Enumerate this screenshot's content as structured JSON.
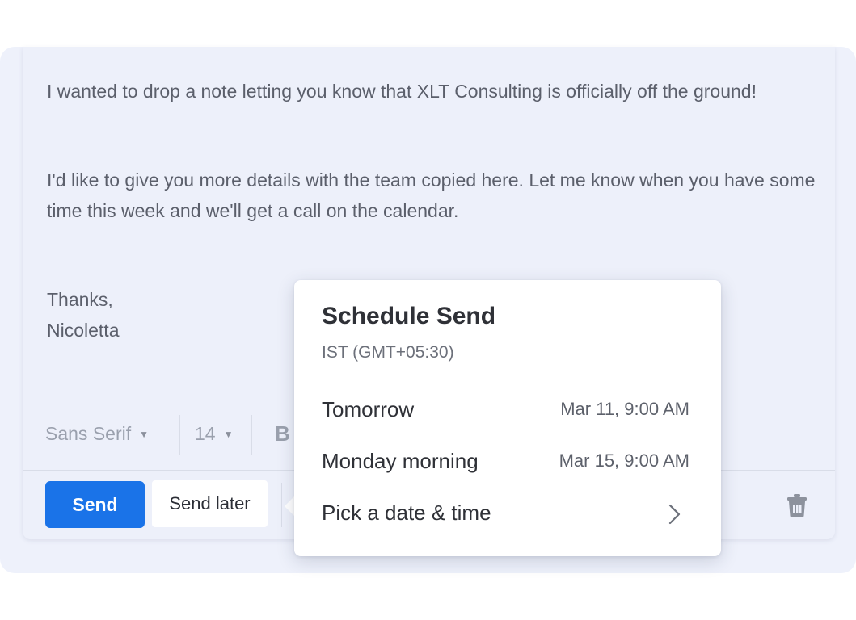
{
  "email": {
    "paragraph1": "I wanted to drop a note letting you know that XLT Consulting is officially off the ground!",
    "paragraph2": "I'd like to give you more details with the team copied here. Let me know when you have some time this week and we'll get a call on the calendar.",
    "closing": "Thanks,",
    "signature": "Nicoletta"
  },
  "format_bar": {
    "font": "Sans Serif",
    "size": "14",
    "bold": "B"
  },
  "actions": {
    "send_label": "Send",
    "send_later_label": "Send later",
    "send_color": "#1a73e8"
  },
  "schedule": {
    "title": "Schedule Send",
    "timezone": "IST (GMT+05:30)",
    "options": [
      {
        "label": "Tomorrow",
        "time": "Mar 11, 9:00 AM"
      },
      {
        "label": "Monday morning",
        "time": "Mar 15, 9:00 AM"
      },
      {
        "label": "Pick a date & time",
        "icon": "chevron-right-icon"
      }
    ]
  }
}
